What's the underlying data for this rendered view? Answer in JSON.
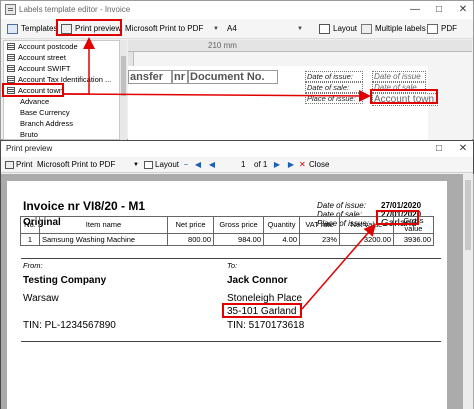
{
  "editor": {
    "title": "Labels template editor - Invoice",
    "toolbar": {
      "templates": "Templates",
      "print_preview": "Print preview",
      "printer": "Microsoft Print to PDF",
      "paper": "A4",
      "layout": "Layout",
      "multiple_labels": "Multiple labels",
      "pdf": "PDF"
    },
    "tree_items": [
      {
        "label": "Account postcode",
        "icon": "field-grid-icon"
      },
      {
        "label": "Account street",
        "icon": "field-grid-icon"
      },
      {
        "label": "Account SWIFT",
        "icon": "field-grid-icon"
      },
      {
        "label": "Account Tax Identification ...",
        "icon": "field-grid-icon"
      },
      {
        "label": "Account town",
        "icon": "field-grid-icon"
      },
      {
        "label": "Advance",
        "icon": "field-grid-icon"
      },
      {
        "label": "Base Currency",
        "icon": "field-grid-icon"
      },
      {
        "label": "Branch Address",
        "icon": "field-grid-icon"
      },
      {
        "label": "Bruto",
        "icon": "field-grid-icon"
      }
    ],
    "ruler_label": "210 mm",
    "header_cells": [
      "ansfer",
      "nr",
      "Document No."
    ],
    "labels": {
      "date_of_issue": "Date of issue:",
      "date_of_sale": "Date of sale:",
      "place_of_issue": "Place of issue:",
      "date_of_issue_field": "Date of issue",
      "date_of_sale_field": "Date of sale",
      "account_town_field": "Account town"
    }
  },
  "preview": {
    "title": "Print preview",
    "toolbar": {
      "print": "Print",
      "printer": "Microsoft Print to PDF",
      "layout": "Layout",
      "page": "1",
      "of": "of 1",
      "close": "Close"
    },
    "invoice": {
      "title": "Invoice nr VI8/20 - M1",
      "subtitle": "Original",
      "date_of_issue_label": "Date of issue:",
      "date_of_issue": "27/01/2020",
      "date_of_sale_label": "Date of sale:",
      "date_of_sale": "27/01/2020",
      "place_of_issue_label": "Place of issue:",
      "place_of_issue": "Garland",
      "from_label": "From:",
      "to_label": "To:",
      "seller": {
        "name": "Testing Company",
        "city": "Warsaw",
        "tin": "TIN:  PL-1234567890"
      },
      "buyer": {
        "name": "Jack Connor",
        "street": "Stoneleigh Place",
        "postal": "35-101  Garland",
        "tin": "TIN:  5170173618"
      },
      "table": {
        "headers": [
          "No.",
          "Item name",
          "Net price",
          "Gross price",
          "Quantity",
          "VAT rate",
          "Net value",
          "Gross value"
        ],
        "rows": [
          [
            "1",
            "Samsung Washing Machine",
            "800.00",
            "984.00",
            "4.00",
            "23%",
            "3200.00",
            "3936.00"
          ]
        ]
      }
    }
  },
  "accent_colors": {
    "highlight_red": "#e00000",
    "nav_blue": "#1e5fb4"
  }
}
